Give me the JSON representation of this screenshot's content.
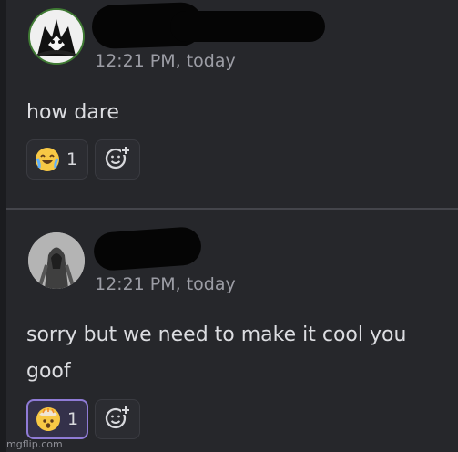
{
  "messages": [
    {
      "timestamp": "12:21 PM, today",
      "text": "how dare",
      "reaction": {
        "emoji": "joy-emoji-icon",
        "count": "1"
      },
      "add_reaction_icon": "add-reaction-icon"
    },
    {
      "timestamp": "12:21 PM, today",
      "text": "sorry but we need to make it cool you goof",
      "reaction": {
        "emoji": "exploding-head-emoji-icon",
        "count": "1",
        "selected_accent": "#8f7bd6"
      },
      "add_reaction_icon": "add-reaction-icon"
    }
  ],
  "watermark": "imgflip.com",
  "colors": {
    "background": "#26272b",
    "text": "#dcdde1",
    "timestamp": "#9c9da5",
    "selected_reaction_border": "#8f7bd6"
  }
}
